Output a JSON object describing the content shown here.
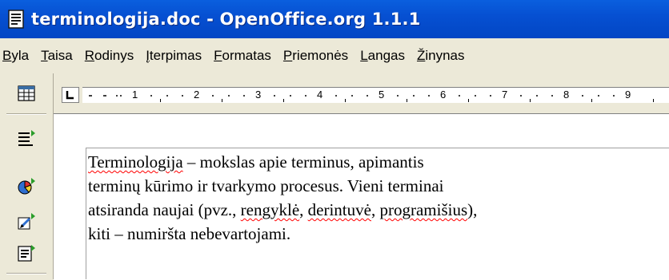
{
  "window": {
    "title": "terminologija.doc - OpenOffice.org 1.1.1"
  },
  "menu": [
    {
      "label": "Byla",
      "accel_index": 0
    },
    {
      "label": "Taisa",
      "accel_index": 0
    },
    {
      "label": "Rodinys",
      "accel_index": 0
    },
    {
      "label": "Įterpimas",
      "accel_index": 0
    },
    {
      "label": "Formatas",
      "accel_index": 0
    },
    {
      "label": "Priemonės",
      "accel_index": 0
    },
    {
      "label": "Langas",
      "accel_index": 0
    },
    {
      "label": "Žinynas",
      "accel_index": 0
    }
  ],
  "left_toolbar": {
    "icons": [
      "table-icon",
      "insert-fields-icon",
      "chart-icon",
      "draw-functions-icon",
      "form-functions-icon"
    ]
  },
  "ruler": {
    "numbers": [
      "1",
      "2",
      "3",
      "4",
      "5",
      "6",
      "7",
      "8",
      "9"
    ]
  },
  "document": {
    "lines": [
      {
        "segments": [
          {
            "text": " ",
            "spell": false
          },
          {
            "text": "Terminologija",
            "spell": true
          },
          {
            "text": " – mokslas apie terminus, apimantis",
            "spell": false
          }
        ]
      },
      {
        "segments": [
          {
            "text": "terminų kūrimo ir tvarkymo procesus. Vieni terminai",
            "spell": false
          }
        ]
      },
      {
        "segments": [
          {
            "text": "atsiranda naujai (pvz., ",
            "spell": false
          },
          {
            "text": "rengyklė",
            "spell": true
          },
          {
            "text": ", ",
            "spell": false
          },
          {
            "text": "derintuvė",
            "spell": true
          },
          {
            "text": ", ",
            "spell": false
          },
          {
            "text": "programišius",
            "spell": true
          },
          {
            "text": "),",
            "spell": false
          }
        ]
      },
      {
        "segments": [
          {
            "text": "kiti – numiršta nebevartojami.",
            "spell": false
          }
        ]
      }
    ]
  },
  "colors": {
    "titlebar": "#0a5fde",
    "chrome": "#ece9d8",
    "spellcheck_underline": "#ff0000"
  }
}
